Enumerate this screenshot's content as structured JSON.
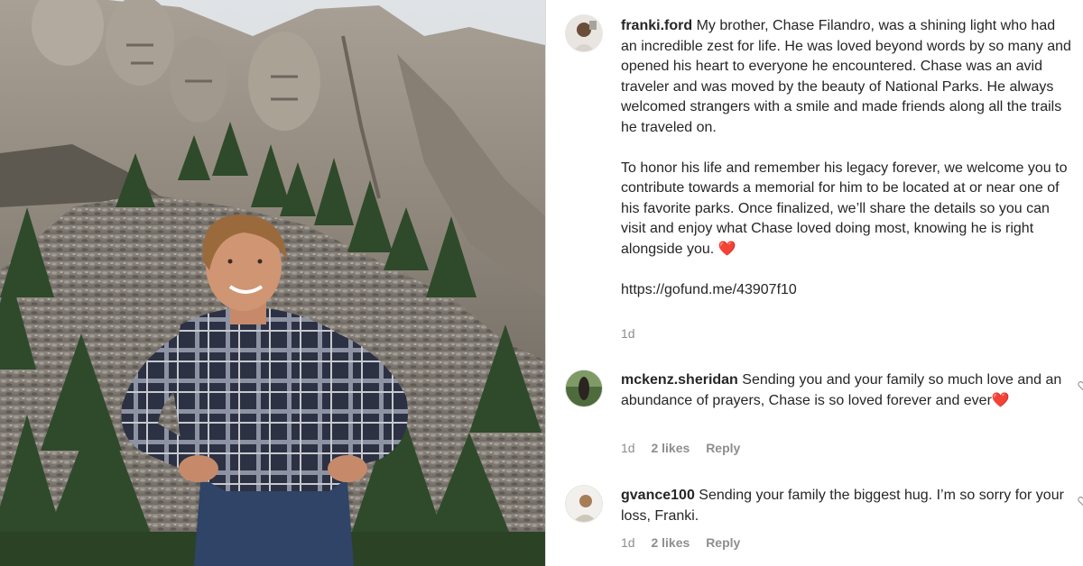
{
  "post": {
    "caption_user": "franki.ford",
    "caption_p1": "My brother, Chase Filandro, was a shining light who had an incredible zest for life. He was loved beyond words by so many and opened his heart to everyone he encountered. Chase was an avid traveler and was moved by the beauty of National Parks. He always welcomed strangers with a smile and made friends along all the trails he traveled on.",
    "caption_p2": "To honor his life and remember his legacy forever, we welcome you to contribute towards a memorial for him to be located at or near one of his favorite parks. Once finalized, we’ll share the details so you can visit and enjoy what Chase loved doing most, knowing he is right alongside you. ❤️",
    "caption_link": "https://gofund.me/43907f10",
    "caption_time": "1d"
  },
  "comments": [
    {
      "user": "mckenz.sheridan",
      "text": "Sending you and your family so much love and an abundance of prayers, Chase is so loved forever and ever❤️",
      "time": "1d",
      "likes": "2 likes",
      "reply": "Reply"
    },
    {
      "user": "gvance100",
      "text": "Sending your family the biggest hug. I’m so sorry for your loss, Franki.",
      "time": "1d",
      "likes": "2 likes",
      "reply": "Reply"
    }
  ],
  "icons": {
    "like": "heart-outline-icon"
  },
  "colors": {
    "text": "#262626",
    "secondary": "#8e8e8e",
    "heart": "#ed4956"
  }
}
